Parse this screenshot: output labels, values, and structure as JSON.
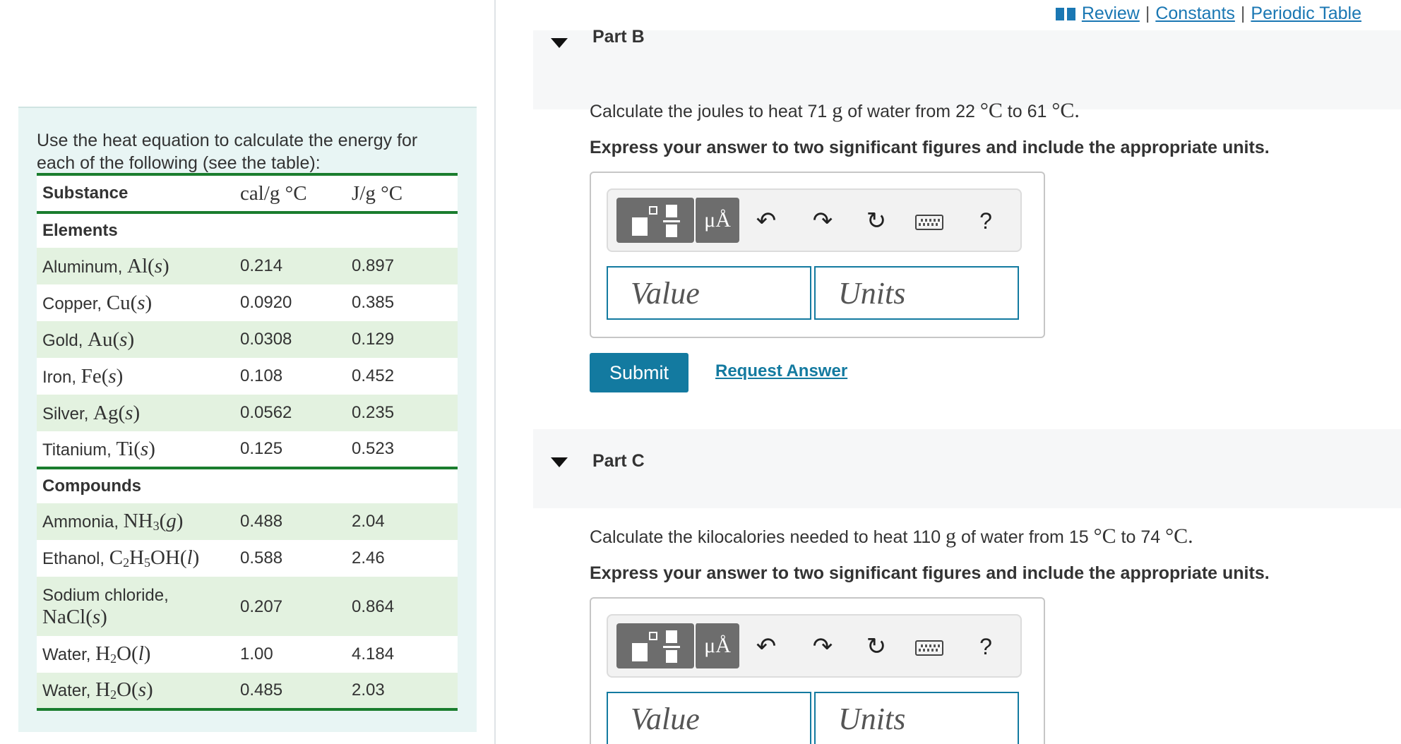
{
  "header": {
    "links": [
      "Review",
      "Constants",
      "Periodic Table"
    ],
    "separator": "|"
  },
  "left": {
    "intro": "Use the heat equation to calculate the energy for each of the following (see the table):",
    "table": {
      "col_substance": "Substance",
      "col_cal": "cal/g °C",
      "col_j": "J/g °C",
      "section_elements": "Elements",
      "section_compounds": "Compounds",
      "rows": [
        {
          "name": "Aluminum, ",
          "formula": "Al(s)",
          "cal": "0.214",
          "j": "0.897"
        },
        {
          "name": "Copper, ",
          "formula": "Cu(s)",
          "cal": "0.0920",
          "j": "0.385"
        },
        {
          "name": "Gold, ",
          "formula": "Au(s)",
          "cal": "0.0308",
          "j": "0.129"
        },
        {
          "name": "Iron, ",
          "formula": "Fe(s)",
          "cal": "0.108",
          "j": "0.452"
        },
        {
          "name": "Silver, ",
          "formula": "Ag(s)",
          "cal": "0.0562",
          "j": "0.235"
        },
        {
          "name": "Titanium, ",
          "formula": "Ti(s)",
          "cal": "0.125",
          "j": "0.523"
        },
        {
          "name": "Ammonia, ",
          "formula": "NH3(g)",
          "cal": "0.488",
          "j": "2.04"
        },
        {
          "name": "Ethanol, ",
          "formula": "C2H5OH(l)",
          "cal": "0.588",
          "j": "2.46"
        },
        {
          "name": "Sodium chloride, ",
          "formula": "NaCl(s)",
          "cal": "0.207",
          "j": "0.864"
        },
        {
          "name": "Water, ",
          "formula": "H2O(l)",
          "cal": "1.00",
          "j": "4.184"
        },
        {
          "name": "Water, ",
          "formula": "H2O(s)",
          "cal": "0.485",
          "j": "2.03"
        }
      ]
    }
  },
  "partB": {
    "title": "Part B",
    "question": {
      "pre": "Calculate the joules to heat 71 ",
      "unit_g": "g",
      "mid": " of water from 22 ",
      "deg1": "°C",
      "to": " to 61 ",
      "deg2": "°C."
    },
    "instruction": "Express your answer to two significant figures and include the appropriate units.",
    "value_placeholder": "Value",
    "units_placeholder": "Units",
    "mu_label": "μÅ",
    "help_label": "?",
    "submit_label": "Submit",
    "request_label": "Request Answer"
  },
  "partC": {
    "title": "Part C",
    "question": {
      "pre": "Calculate the kilocalories needed to heat 110 ",
      "unit_g": "g",
      "mid": " of water from 15 ",
      "deg1": "°C",
      "to": " to 74 ",
      "deg2": "°C."
    },
    "instruction": "Express your answer to two significant figures and include the appropriate units.",
    "value_placeholder": "Value",
    "units_placeholder": "Units",
    "mu_label": "μÅ",
    "help_label": "?"
  },
  "colors": {
    "accent": "#137aa0",
    "link": "#1a77b3",
    "table_rule": "#1a7d2e",
    "row_shade": "#e3f2e0",
    "panel_bg": "#e8f5f4"
  }
}
